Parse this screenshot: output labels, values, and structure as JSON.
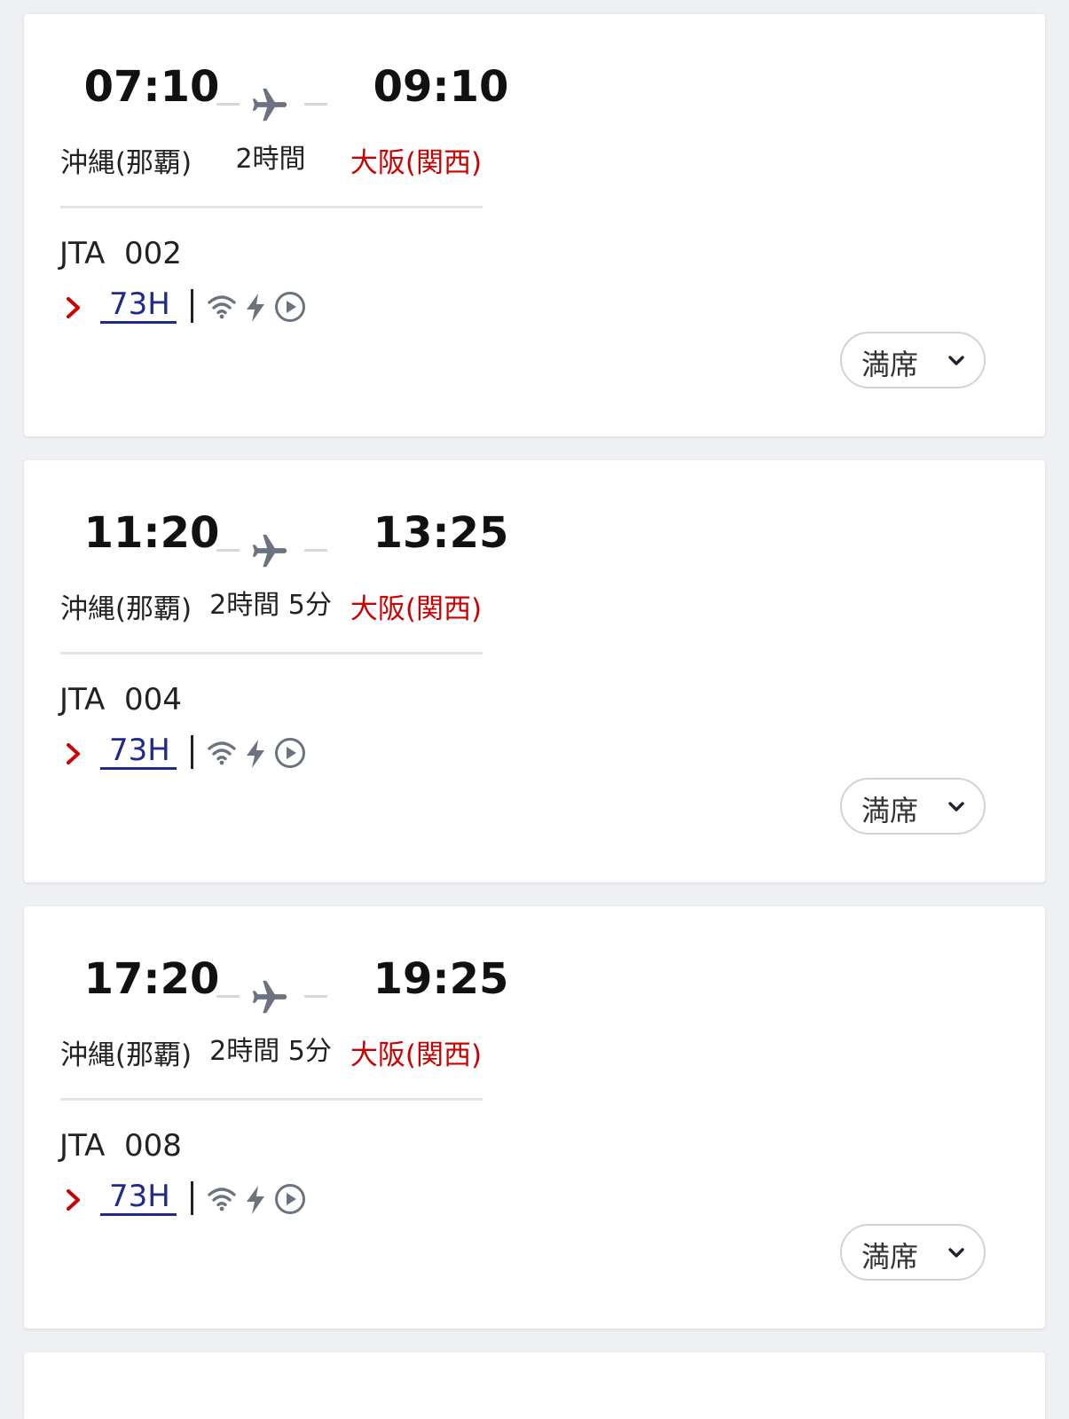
{
  "flights": [
    {
      "dep_time": "07:10",
      "arr_time": "09:10",
      "dep_station": "沖縄(那覇)",
      "arr_station": "大阪(関西)",
      "duration": "2時間",
      "flight_no": "JTA  002",
      "equipment": "73H",
      "status": "満席"
    },
    {
      "dep_time": "11:20",
      "arr_time": "13:25",
      "dep_station": "沖縄(那覇)",
      "arr_station": "大阪(関西)",
      "duration": "2時間 5分",
      "flight_no": "JTA  004",
      "equipment": "73H",
      "status": "満席"
    },
    {
      "dep_time": "17:20",
      "arr_time": "19:25",
      "dep_station": "沖縄(那覇)",
      "arr_station": "大阪(関西)",
      "duration": "2時間 5分",
      "flight_no": "JTA  008",
      "equipment": "73H",
      "status": "満席"
    }
  ],
  "icons": {
    "route": "airplane-icon",
    "equipment_chevron": "chevron-right-icon",
    "amenities": [
      "wifi-icon",
      "power-icon",
      "play-icon"
    ],
    "status_chevron": "chevron-down-icon"
  },
  "colors": {
    "arrival_station": "#cc0000",
    "equipment_link": "#1f2a8c",
    "chevron_red": "#cc0000",
    "icon_gray": "#6b7280"
  }
}
